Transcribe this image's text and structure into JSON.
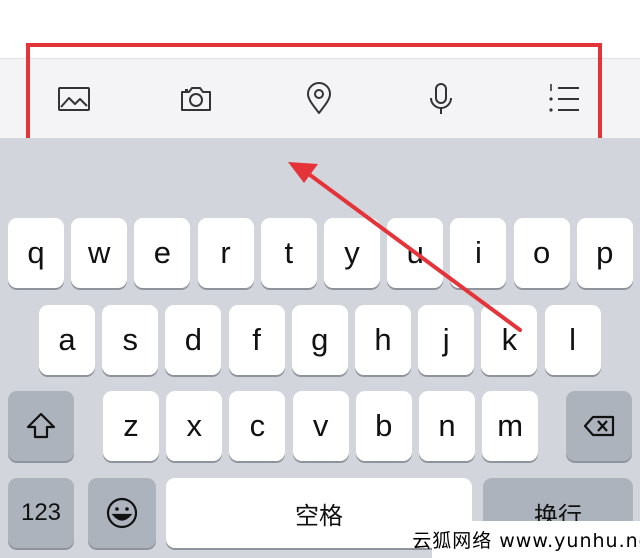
{
  "toolbar": {
    "tools": [
      {
        "icon": "image-icon"
      },
      {
        "icon": "camera-icon"
      },
      {
        "icon": "location-pin-icon"
      },
      {
        "icon": "microphone-icon"
      },
      {
        "icon": "numbered-list-icon"
      }
    ]
  },
  "annotation": {
    "highlight_color": "#e5333a"
  },
  "keyboard": {
    "row1": [
      "q",
      "w",
      "e",
      "r",
      "t",
      "y",
      "u",
      "i",
      "o",
      "p"
    ],
    "row2": [
      "a",
      "s",
      "d",
      "f",
      "g",
      "h",
      "j",
      "k",
      "l"
    ],
    "row3": [
      "z",
      "x",
      "c",
      "v",
      "b",
      "n",
      "m"
    ],
    "shift_icon": "shift-arrow-icon",
    "delete_icon": "backspace-icon",
    "numbers_label": "123",
    "emoji_icon": "emoji-icon",
    "space_label": "空格",
    "return_label": "换行"
  },
  "watermark": {
    "text": "云狐网络 www.yunhu.net"
  }
}
